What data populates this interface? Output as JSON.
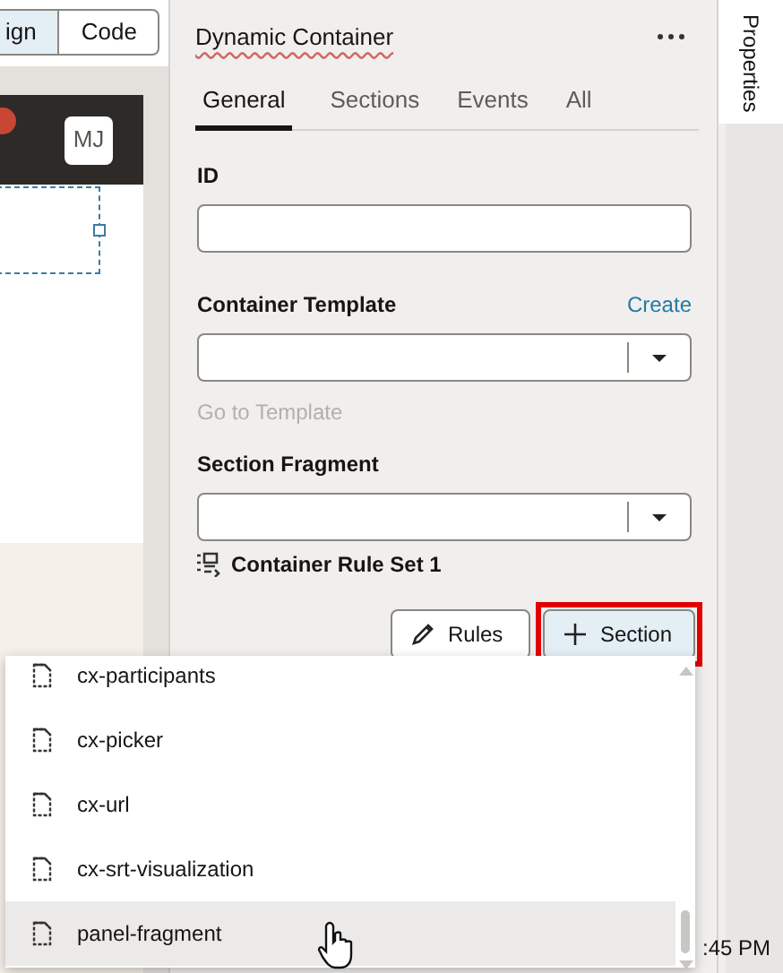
{
  "canvas": {
    "view_toggle": [
      {
        "label": "ign",
        "selected": true
      },
      {
        "label": "Code",
        "selected": false
      }
    ],
    "avatar": "MJ"
  },
  "panel": {
    "title": "Dynamic Container",
    "tabs": [
      {
        "label": "General",
        "selected": true
      },
      {
        "label": "Sections",
        "selected": false
      },
      {
        "label": "Events",
        "selected": false
      },
      {
        "label": "All",
        "selected": false
      }
    ],
    "fields": [
      {
        "label": "ID",
        "kind": "text"
      },
      {
        "label": "Container Template",
        "kind": "select",
        "action": "Create",
        "link": {
          "label": "Go to Template",
          "disabled": true
        }
      },
      {
        "label": "Section Fragment",
        "kind": "select"
      }
    ],
    "rule_set": "Container Rule Set 1",
    "buttons": [
      {
        "label": "Rules",
        "kind": "rules",
        "highlighted": false
      },
      {
        "label": "Section",
        "kind": "add",
        "highlighted": true
      }
    ]
  },
  "side_tab": "Properties",
  "dropdown": {
    "items": [
      {
        "label": "cx-participants",
        "selected": false
      },
      {
        "label": "cx-picker",
        "selected": false
      },
      {
        "label": "cx-url",
        "selected": false
      },
      {
        "label": "cx-srt-visualization",
        "selected": false
      },
      {
        "label": "panel-fragment",
        "selected": true
      }
    ]
  },
  "status_time": ":45 PM"
}
